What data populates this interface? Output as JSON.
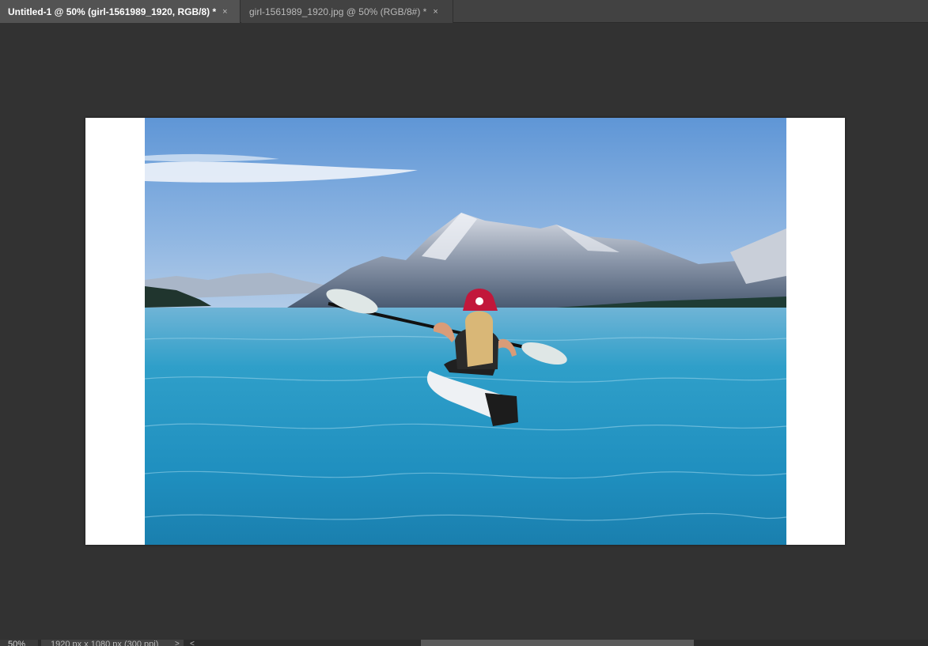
{
  "tabs": [
    {
      "label": "Untitled-1 @ 50% (girl-1561989_1920, RGB/8) *",
      "close": "×",
      "active": true
    },
    {
      "label": "girl-1561989_1920.jpg @ 50% (RGB/8#) *",
      "close": "×",
      "active": false
    }
  ],
  "status": {
    "zoom": "50%",
    "doc_size": "1920 px x 1080 px (300 ppi)",
    "arrow_right": ">",
    "arrow_left": "<"
  },
  "colors": {
    "app_background": "#323232",
    "tab_active": "#535353",
    "tab_inactive": "#424242",
    "canvas": "#ffffff"
  },
  "canvas": {
    "image_subject": "photo: woman in red cap paddling white kayak on turquoise lake with mountains"
  }
}
